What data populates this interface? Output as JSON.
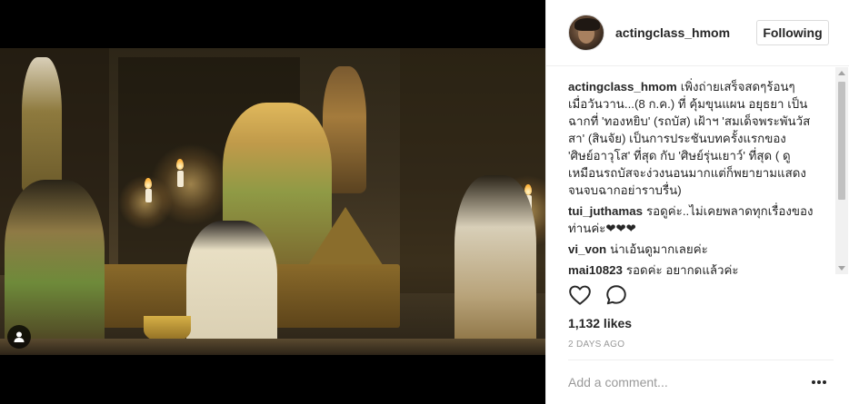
{
  "post": {
    "username": "actingclass_hmom",
    "follow_button": "Following",
    "comments": [
      {
        "author": "actingclass_hmom",
        "text": "เพิ่งถ่ายเสร็จสดๆร้อนๆเมื่อวันวาน...(8 ก.ค.) ที่ คุ้มขุนแผน อยุธยา เป็นฉากที่ 'ทองหยิบ' (รถบัส) เฝ้าฯ 'สมเด็จพระพันวัสสา' (สินจัย) เป็นการประชันบทครั้งแรกของ 'ศิษย์อาวุโส' ที่สุด กับ 'ศิษย์รุ่นเยาว์' ที่สุด ( ดูเหมือนรถบัสจะง่วงนอนมากแต่ก็พยายามแสดงจนจบฉากอย่าราบรื่น)"
      },
      {
        "author": "tui_juthamas",
        "text": "รอดูค่ะ..ไม่เคยพลาดทุกเรื่องของท่านค่ะ❤❤❤"
      },
      {
        "author": "vi_von",
        "text": "น่าเอ้นดูมากเลยค่ะ"
      },
      {
        "author": "mai10823",
        "text": "รอดูค่ะ อยากดูแล้วค่ะ"
      }
    ],
    "likes": "1,132 likes",
    "timestamp": "2 DAYS AGO",
    "comment_placeholder": "Add a comment..."
  },
  "icons": {
    "like": "heart-icon",
    "comment": "speech-bubble-icon",
    "more": "ellipsis-icon",
    "tagged_user": "user-tag-icon"
  },
  "colors": {
    "text": "#262626",
    "muted": "#999999",
    "border": "#efefef",
    "media_bg": "#000000"
  }
}
